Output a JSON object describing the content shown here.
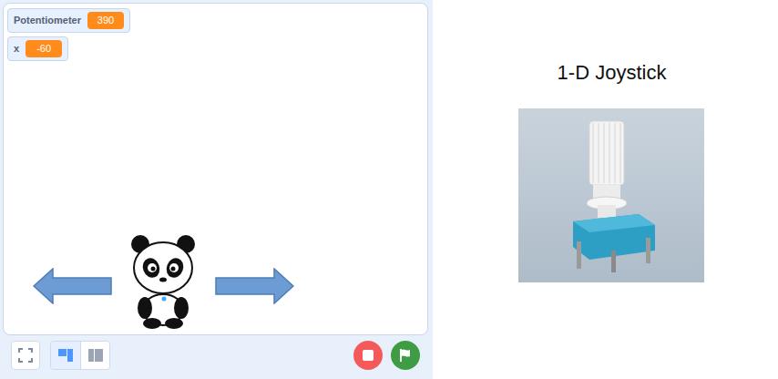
{
  "stage": {
    "monitors": [
      {
        "label": "Potentiometer",
        "value": "390"
      },
      {
        "label": "x",
        "value": "-60"
      }
    ]
  },
  "controls": {
    "layout_buttons": [
      {
        "label": "small-stage",
        "selected": true
      },
      {
        "label": "large-stage",
        "selected": false
      }
    ]
  },
  "caption": {
    "title": "1-D Joystick"
  }
}
